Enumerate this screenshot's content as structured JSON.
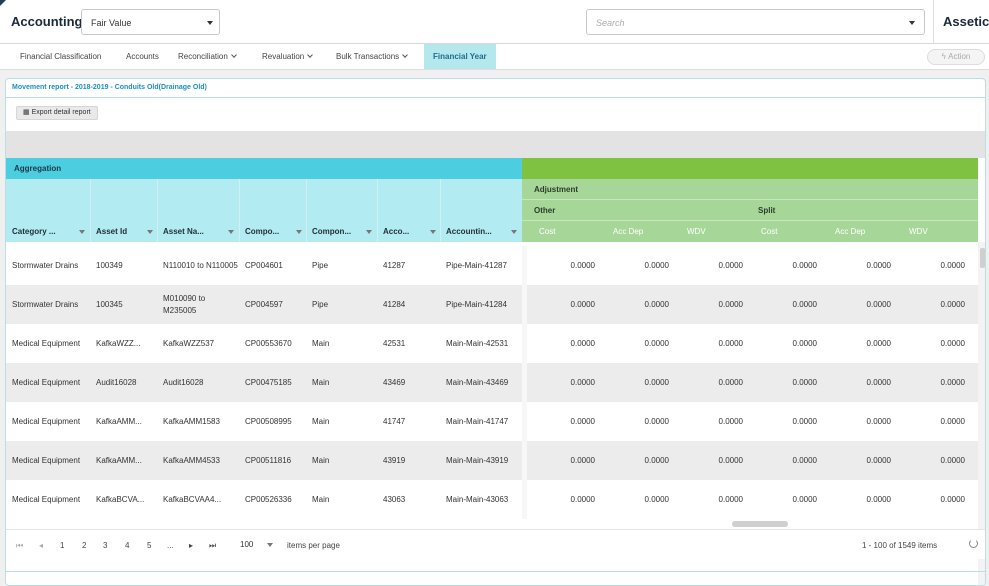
{
  "header": {
    "app_title": "Accounting",
    "fair_value_select": "Fair Value",
    "search_placeholder": "Search",
    "brand": "Assetic"
  },
  "nav": {
    "tabs": [
      {
        "label": "Financial Classification"
      },
      {
        "label": "Accounts"
      },
      {
        "label": "Reconciliation"
      },
      {
        "label": "Revaluation"
      },
      {
        "label": "Bulk Transactions"
      },
      {
        "label": "Financial Year"
      }
    ],
    "active_tab": "Financial Year",
    "action_label": "Action"
  },
  "panel": {
    "title": "Movement report - 2018-2019 - Conduits Old(Drainage Old)",
    "export_label": "Export detail report"
  },
  "grid": {
    "aggregation_label": "Aggregation",
    "adjustment_label": "Adjustment",
    "other_label": "Other",
    "split_label": "Split",
    "columns": [
      "Category ...",
      "Asset Id",
      "Asset Na...",
      "Compo...",
      "Compon...",
      "Acco...",
      "Accountin..."
    ],
    "value_columns": [
      "Cost",
      "Acc Dep",
      "WDV",
      "Cost",
      "Acc Dep",
      "WDV"
    ],
    "rows": [
      {
        "category": "Stormwater Drains",
        "asset_id": "100349",
        "asset_name": "N110010 to N110005",
        "component": "CP004601",
        "component_type": "Pipe",
        "account": "41287",
        "accounting": "Pipe-Main-41287",
        "values": [
          "0.0000",
          "0.0000",
          "0.0000",
          "0.0000",
          "0.0000",
          "0.0000"
        ]
      },
      {
        "category": "Stormwater Drains",
        "asset_id": "100345",
        "asset_name": "M010090 to M235005",
        "component": "CP004597",
        "component_type": "Pipe",
        "account": "41284",
        "accounting": "Pipe-Main-41284",
        "values": [
          "0.0000",
          "0.0000",
          "0.0000",
          "0.0000",
          "0.0000",
          "0.0000"
        ]
      },
      {
        "category": "Medical Equipment",
        "asset_id": "KafkaWZZ...",
        "asset_name": "KafkaWZZ537",
        "component": "CP00553670",
        "component_type": "Main",
        "account": "42531",
        "accounting": "Main-Main-42531",
        "values": [
          "0.0000",
          "0.0000",
          "0.0000",
          "0.0000",
          "0.0000",
          "0.0000"
        ]
      },
      {
        "category": "Medical Equipment",
        "asset_id": "Audit16028",
        "asset_name": "Audit16028",
        "component": "CP00475185",
        "component_type": "Main",
        "account": "43469",
        "accounting": "Main-Main-43469",
        "values": [
          "0.0000",
          "0.0000",
          "0.0000",
          "0.0000",
          "0.0000",
          "0.0000"
        ]
      },
      {
        "category": "Medical Equipment",
        "asset_id": "KafkaAMM...",
        "asset_name": "KafkaAMM1583",
        "component": "CP00508995",
        "component_type": "Main",
        "account": "41747",
        "accounting": "Main-Main-41747",
        "values": [
          "0.0000",
          "0.0000",
          "0.0000",
          "0.0000",
          "0.0000",
          "0.0000"
        ]
      },
      {
        "category": "Medical Equipment",
        "asset_id": "KafkaAMM...",
        "asset_name": "KafkaAMM4533",
        "component": "CP00511816",
        "component_type": "Main",
        "account": "43919",
        "accounting": "Main-Main-43919",
        "values": [
          "0.0000",
          "0.0000",
          "0.0000",
          "0.0000",
          "0.0000",
          "0.0000"
        ]
      },
      {
        "category": "Medical Equipment",
        "asset_id": "KafkaBCVA...",
        "asset_name": "KafkaBCVAA4...",
        "component": "CP00526336",
        "component_type": "Main",
        "account": "43063",
        "accounting": "Main-Main-43063",
        "values": [
          "0.0000",
          "0.0000",
          "0.0000",
          "0.0000",
          "0.0000",
          "0.0000"
        ]
      }
    ]
  },
  "pager": {
    "pages": [
      "1",
      "2",
      "3",
      "4",
      "5",
      "..."
    ],
    "page_size": "100",
    "items_per_page_label": "items per page",
    "range_text": "1 - 100 of 1549 items"
  }
}
